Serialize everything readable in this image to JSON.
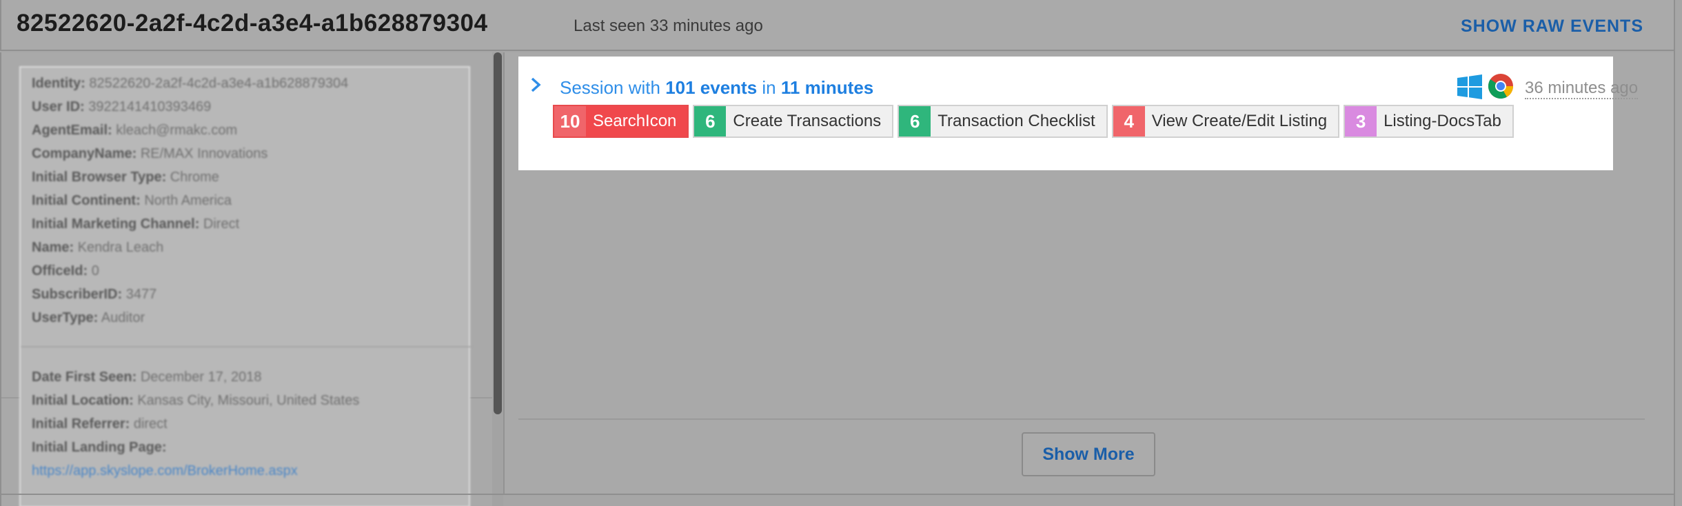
{
  "header": {
    "user_id": "82522620-2a2f-4c2d-a3e4-a1b628879304",
    "last_seen": "Last seen 33 minutes ago",
    "raw_events_label": "SHOW RAW EVENTS"
  },
  "properties": {
    "group1": [
      {
        "key": "Identity:",
        "value": "82522620-2a2f-4c2d-a3e4-a1b628879304"
      },
      {
        "key": "User ID:",
        "value": "3922141410393469"
      },
      {
        "key": "AgentEmail:",
        "value": "kleach@rmakc.com"
      },
      {
        "key": "CompanyName:",
        "value": "RE/MAX Innovations"
      },
      {
        "key": "Initial Browser Type:",
        "value": "Chrome"
      },
      {
        "key": "Initial Continent:",
        "value": "North America"
      },
      {
        "key": "Initial Marketing Channel:",
        "value": "Direct"
      },
      {
        "key": "Name:",
        "value": "Kendra Leach"
      },
      {
        "key": "OfficeId:",
        "value": "0"
      },
      {
        "key": "SubscriberID:",
        "value": "3477"
      },
      {
        "key": "UserType:",
        "value": "Auditor"
      }
    ],
    "group2": [
      {
        "key": "Date First Seen:",
        "value": "December 17, 2018"
      },
      {
        "key": "Initial Location:",
        "value": "Kansas City, Missouri, United States"
      },
      {
        "key": "Initial Referrer:",
        "value": "direct"
      },
      {
        "key": "Initial Landing Page:",
        "value": ""
      }
    ],
    "landing_link": "https://app.skyslope.com/BrokerHome.aspx"
  },
  "session": {
    "prefix": "Session with ",
    "events": "101 events",
    "middle": " in ",
    "duration": "11 minutes",
    "time_ago": "36 minutes ago",
    "os_icon": "windows-icon",
    "browser_icon": "chrome-icon",
    "chips": [
      {
        "count": "10",
        "label": "SearchIcon",
        "color": "#f0656a",
        "highlight": true
      },
      {
        "count": "6",
        "label": "Create Transactions",
        "color": "#2fb67c",
        "highlight": false
      },
      {
        "count": "6",
        "label": "Transaction Checklist",
        "color": "#2fb67c",
        "highlight": false
      },
      {
        "count": "4",
        "label": "View Create/Edit Listing",
        "color": "#f0656a",
        "highlight": false
      },
      {
        "count": "3",
        "label": "Listing-DocsTab",
        "color": "#d98ae0",
        "highlight": false
      }
    ]
  },
  "footer": {
    "show_more_label": "Show More"
  },
  "colors": {
    "accent": "#1a5ea8",
    "session_link": "#2f8ee8"
  }
}
